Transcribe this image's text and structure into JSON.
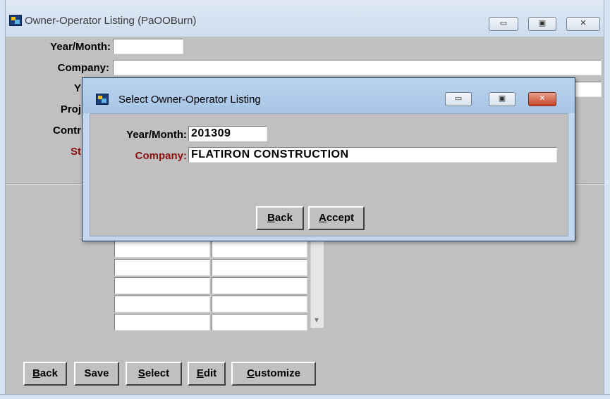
{
  "main_window": {
    "title": "Owner-Operator Listing (PaOOBurn)",
    "fields": {
      "year_month_label": "Year/Month:",
      "year_month_value": "",
      "company_label": "Company:",
      "company_value": "",
      "row3_label_partial": "Y",
      "row3_value": "",
      "project_label_partial": "Proj",
      "contract_label_partial": "Contr",
      "status_label_partial": "St"
    },
    "buttons": {
      "back": {
        "pre": "",
        "ul": "B",
        "post": "ack"
      },
      "save": {
        "pre": "Save",
        "ul": "",
        "post": ""
      },
      "select": {
        "pre": "",
        "ul": "S",
        "post": "elect"
      },
      "edit": {
        "pre": "",
        "ul": "E",
        "post": "dit"
      },
      "customize": {
        "pre": "",
        "ul": "C",
        "post": "ustomize"
      }
    }
  },
  "dialog": {
    "title": "Select Owner-Operator Listing",
    "year_month_label": "Year/Month:",
    "year_month_value": "201309",
    "company_label": "Company:",
    "company_value": "FLATIRON CONSTRUCTION",
    "buttons": {
      "back": {
        "ul": "B",
        "post": "ack"
      },
      "accept": {
        "ul": "A",
        "post": "ccept"
      }
    }
  },
  "caption_glyphs": {
    "minimize": "▭",
    "maximize": "▣",
    "close": "✕"
  },
  "icons": [
    "app-icon",
    "minimize-icon",
    "maximize-icon",
    "close-icon",
    "scroll-down-icon"
  ],
  "colors": {
    "title_bar": "#cddcee",
    "dialog_frame": "#c4d6ec",
    "face": "#c0c0c0",
    "required_label": "#8b1010",
    "close_button": "#c4452c"
  }
}
